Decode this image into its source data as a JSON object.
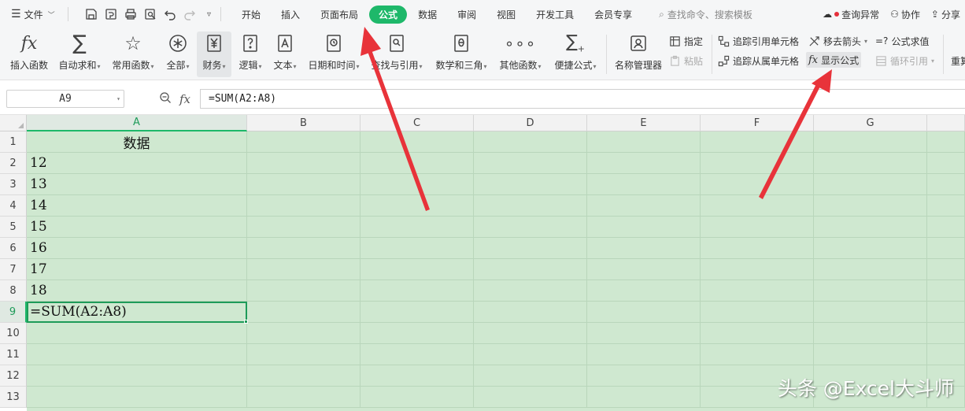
{
  "menubar": {
    "file_label": "文件",
    "tabs": [
      "开始",
      "插入",
      "页面布局",
      "公式",
      "数据",
      "审阅",
      "视图",
      "开发工具",
      "会员专享"
    ],
    "active_tab": "公式",
    "search_placeholder": "查找命令、搜索模板",
    "right_actions": {
      "issues": "查询异常",
      "collab": "协作",
      "share": "分享"
    }
  },
  "ribbon": {
    "insert_function": "插入函数",
    "autosum": "自动求和",
    "common_functions": "常用函数",
    "all": "全部",
    "finance": "财务",
    "logic": "逻辑",
    "text": "文本",
    "date_time": "日期和时间",
    "lookup_ref": "查找与引用",
    "math_trig": "数学和三角",
    "other_functions": "其他函数",
    "quick_formula": "便捷公式",
    "name_manager": "名称管理器",
    "define": "指定",
    "paste": "粘贴",
    "trace_precedents": "追踪引用单元格",
    "trace_dependents": "追踪从属单元格",
    "remove_arrows": "移去箭头",
    "show_formulas": "显示公式",
    "evaluate_formula": "公式求值",
    "evaluate_prefix": "=?",
    "circular_ref": "循环引用",
    "recalc": "重算"
  },
  "formula_bar": {
    "name_box": "A9",
    "formula": "=SUM(A2:A8)"
  },
  "sheet": {
    "columns": [
      "A",
      "B",
      "C",
      "D",
      "E",
      "F",
      "G"
    ],
    "rows": [
      "1",
      "2",
      "3",
      "4",
      "5",
      "6",
      "7",
      "8",
      "9",
      "10",
      "11",
      "12",
      "13"
    ],
    "active_column": "A",
    "active_row": "9",
    "cells": {
      "A1": "数据",
      "A2": "12",
      "A3": "13",
      "A4": "14",
      "A5": "15",
      "A6": "16",
      "A7": "17",
      "A8": "18",
      "A9": "=SUM(A2:A8)"
    }
  },
  "colors": {
    "accent": "#1eb86a",
    "cell_fill": "#cfe8d0",
    "arrow": "#e8333a"
  },
  "watermark": "头条 @Excel大斗师"
}
